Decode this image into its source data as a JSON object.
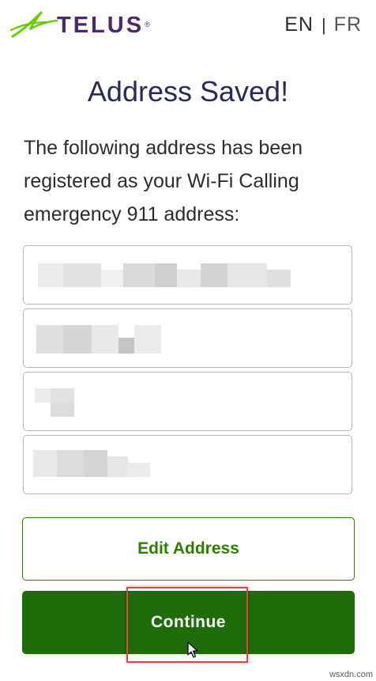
{
  "header": {
    "brand": "TELUS",
    "brand_reg": "®",
    "lang_en": "EN",
    "lang_sep": "|",
    "lang_fr": "FR"
  },
  "main": {
    "title": "Address Saved!",
    "message": "The following address has been registered as your Wi-Fi Calling emergency 911 address:",
    "address_fields": [
      "",
      "",
      "",
      ""
    ]
  },
  "actions": {
    "edit_label": "Edit Address",
    "continue_label": "Continue"
  },
  "watermark": "wsxdn.com",
  "colors": {
    "brand_purple": "#4b286d",
    "brand_green": "#2b8000",
    "continue_bg": "#1f6c0b",
    "highlight_red": "#e0463f"
  },
  "icons": {
    "logo": "telus-leaf-icon",
    "cursor": "mouse-pointer-icon"
  }
}
